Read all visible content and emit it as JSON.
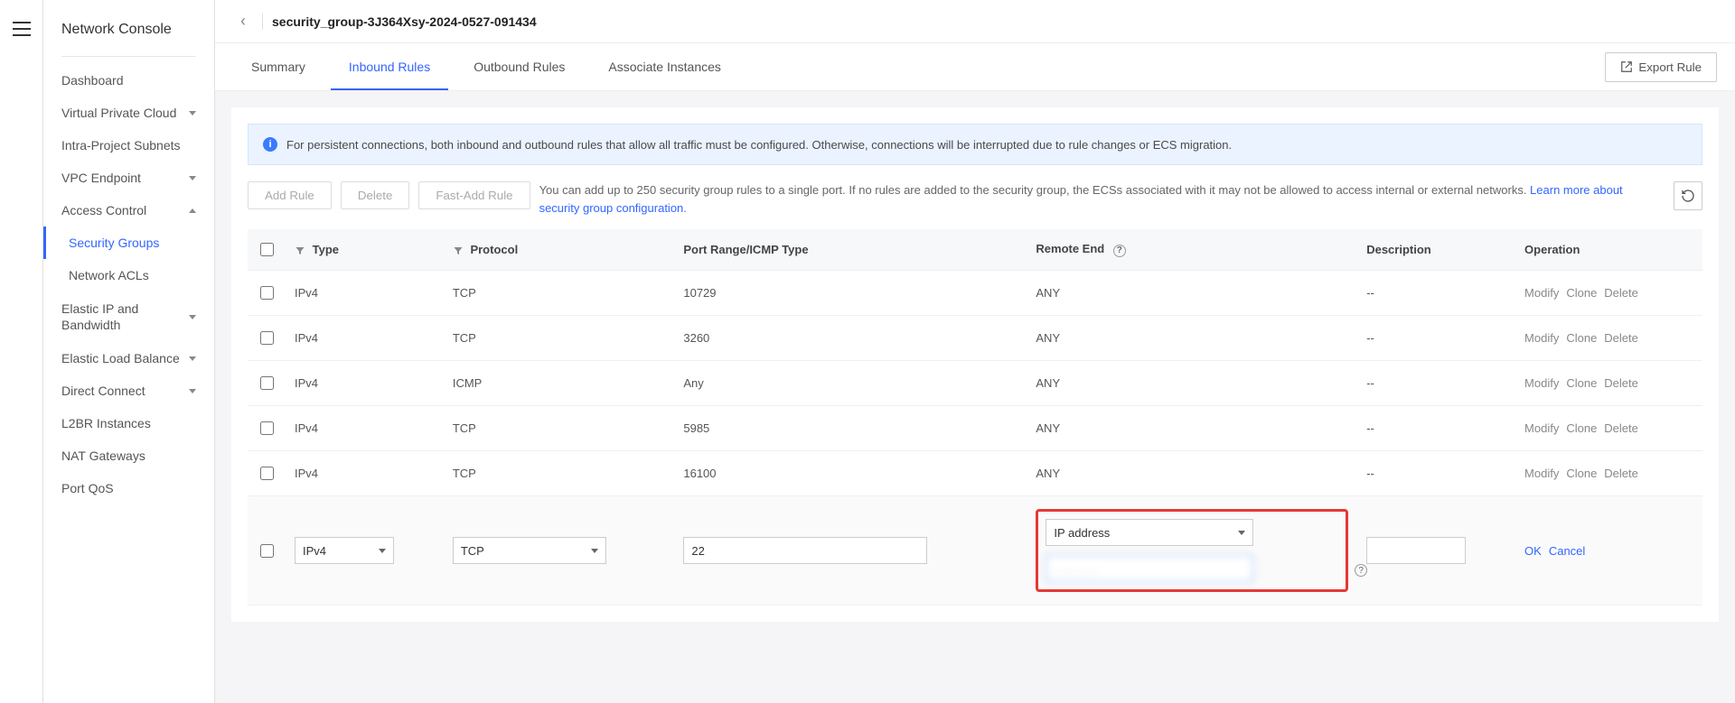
{
  "sidebar": {
    "title": "Network Console",
    "items": [
      {
        "label": "Dashboard",
        "expandable": false
      },
      {
        "label": "Virtual Private Cloud",
        "expandable": true,
        "expanded": false
      },
      {
        "label": "Intra-Project Subnets",
        "expandable": false
      },
      {
        "label": "VPC Endpoint",
        "expandable": true,
        "expanded": false
      },
      {
        "label": "Access Control",
        "expandable": true,
        "expanded": true,
        "children": [
          {
            "label": "Security Groups",
            "active": true
          },
          {
            "label": "Network ACLs",
            "active": false
          }
        ]
      },
      {
        "label": "Elastic IP and Bandwidth",
        "expandable": true,
        "expanded": false
      },
      {
        "label": "Elastic Load Balance",
        "expandable": true,
        "expanded": false
      },
      {
        "label": "Direct Connect",
        "expandable": true,
        "expanded": false
      },
      {
        "label": "L2BR Instances",
        "expandable": false
      },
      {
        "label": "NAT Gateways",
        "expandable": false
      },
      {
        "label": "Port QoS",
        "expandable": false
      }
    ]
  },
  "header": {
    "title": "security_group-3J364Xsy-2024-0527-091434"
  },
  "tabs": [
    {
      "label": "Summary",
      "active": false
    },
    {
      "label": "Inbound Rules",
      "active": true
    },
    {
      "label": "Outbound Rules",
      "active": false
    },
    {
      "label": "Associate Instances",
      "active": false
    }
  ],
  "buttons": {
    "export_rule": "Export Rule",
    "add_rule": "Add Rule",
    "delete": "Delete",
    "fast_add": "Fast-Add Rule"
  },
  "notice": "For persistent connections, both inbound and outbound rules that allow all traffic must be configured. Otherwise, connections will be interrupted due to rule changes or ECS migration.",
  "help_text": {
    "line": "You can add up to 250 security group rules to a single port.      If no rules are added to the security group, the ECSs associated with it may not be allowed to access internal or external networks.  ",
    "link": "Learn more about security group configuration."
  },
  "table": {
    "columns": {
      "type": "Type",
      "protocol": "Protocol",
      "port": "Port Range/ICMP Type",
      "remote": "Remote End",
      "description": "Description",
      "operation": "Operation"
    },
    "op_labels": {
      "modify": "Modify",
      "clone": "Clone",
      "delete": "Delete"
    },
    "rows": [
      {
        "type": "IPv4",
        "protocol": "TCP",
        "port": "10729",
        "remote": "ANY",
        "description": "--"
      },
      {
        "type": "IPv4",
        "protocol": "TCP",
        "port": "3260",
        "remote": "ANY",
        "description": "--"
      },
      {
        "type": "IPv4",
        "protocol": "ICMP",
        "port": "Any",
        "remote": "ANY",
        "description": "--"
      },
      {
        "type": "IPv4",
        "protocol": "TCP",
        "port": "5985",
        "remote": "ANY",
        "description": "--"
      },
      {
        "type": "IPv4",
        "protocol": "TCP",
        "port": "16100",
        "remote": "ANY",
        "description": "--"
      }
    ]
  },
  "edit_row": {
    "type": "IPv4",
    "protocol": "TCP",
    "port": "22",
    "remote_type": "IP address",
    "remote_value": "........ , ..",
    "ok": "OK",
    "cancel": "Cancel"
  }
}
